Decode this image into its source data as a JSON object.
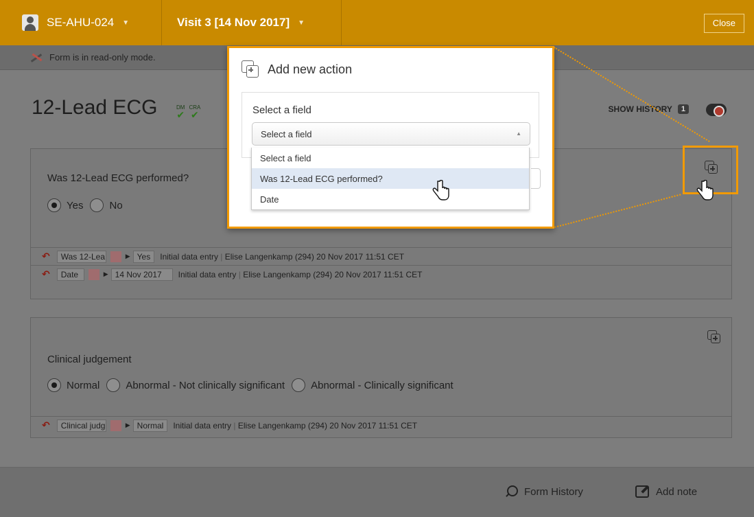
{
  "header": {
    "subject_id": "SE-AHU-024",
    "visit": "Visit 3 [14 Nov 2017]",
    "close_label": "Close"
  },
  "readonly_notice": "Form is in read-only mode.",
  "form": {
    "title": "12-Lead ECG",
    "badges": [
      "DM",
      "CRA"
    ],
    "show_history_label": "SHOW HISTORY",
    "show_history_count": "1"
  },
  "section1": {
    "question": "Was 12-Lead ECG performed?",
    "options": [
      "Yes",
      "No"
    ],
    "selected": "Yes",
    "history": [
      {
        "field": "Was 12-Lea",
        "value": "Yes",
        "action": "Initial data entry",
        "user": "Elise Langenkamp (294) 20 Nov 2017 11:51 CET"
      },
      {
        "field": "Date",
        "value": "14 Nov 2017",
        "action": "Initial data entry",
        "user": "Elise Langenkamp (294) 20 Nov 2017 11:51 CET"
      }
    ]
  },
  "section2": {
    "question": "Clinical judgement",
    "options": [
      "Normal",
      "Abnormal - Not clinically significant",
      "Abnormal - Clinically significant"
    ],
    "selected": "Normal",
    "history": [
      {
        "field": "Clinical judg",
        "value": "Normal",
        "action": "Initial data entry",
        "user": "Elise Langenkamp (294) 20 Nov 2017 11:51 CET"
      }
    ]
  },
  "footer": {
    "form_history_label": "Form History",
    "add_note_label": "Add note"
  },
  "popover": {
    "title": "Add new action",
    "field_label": "Select a field",
    "select_value": "Select a field",
    "options": [
      "Select a field",
      "Was 12-Lead ECG performed?",
      "Date"
    ],
    "highlighted_option": "Was 12-Lead ECG performed?"
  },
  "colors": {
    "topbar": "#c98a00",
    "highlight": "#f29a00",
    "option_hover": "#dfe8f4"
  }
}
